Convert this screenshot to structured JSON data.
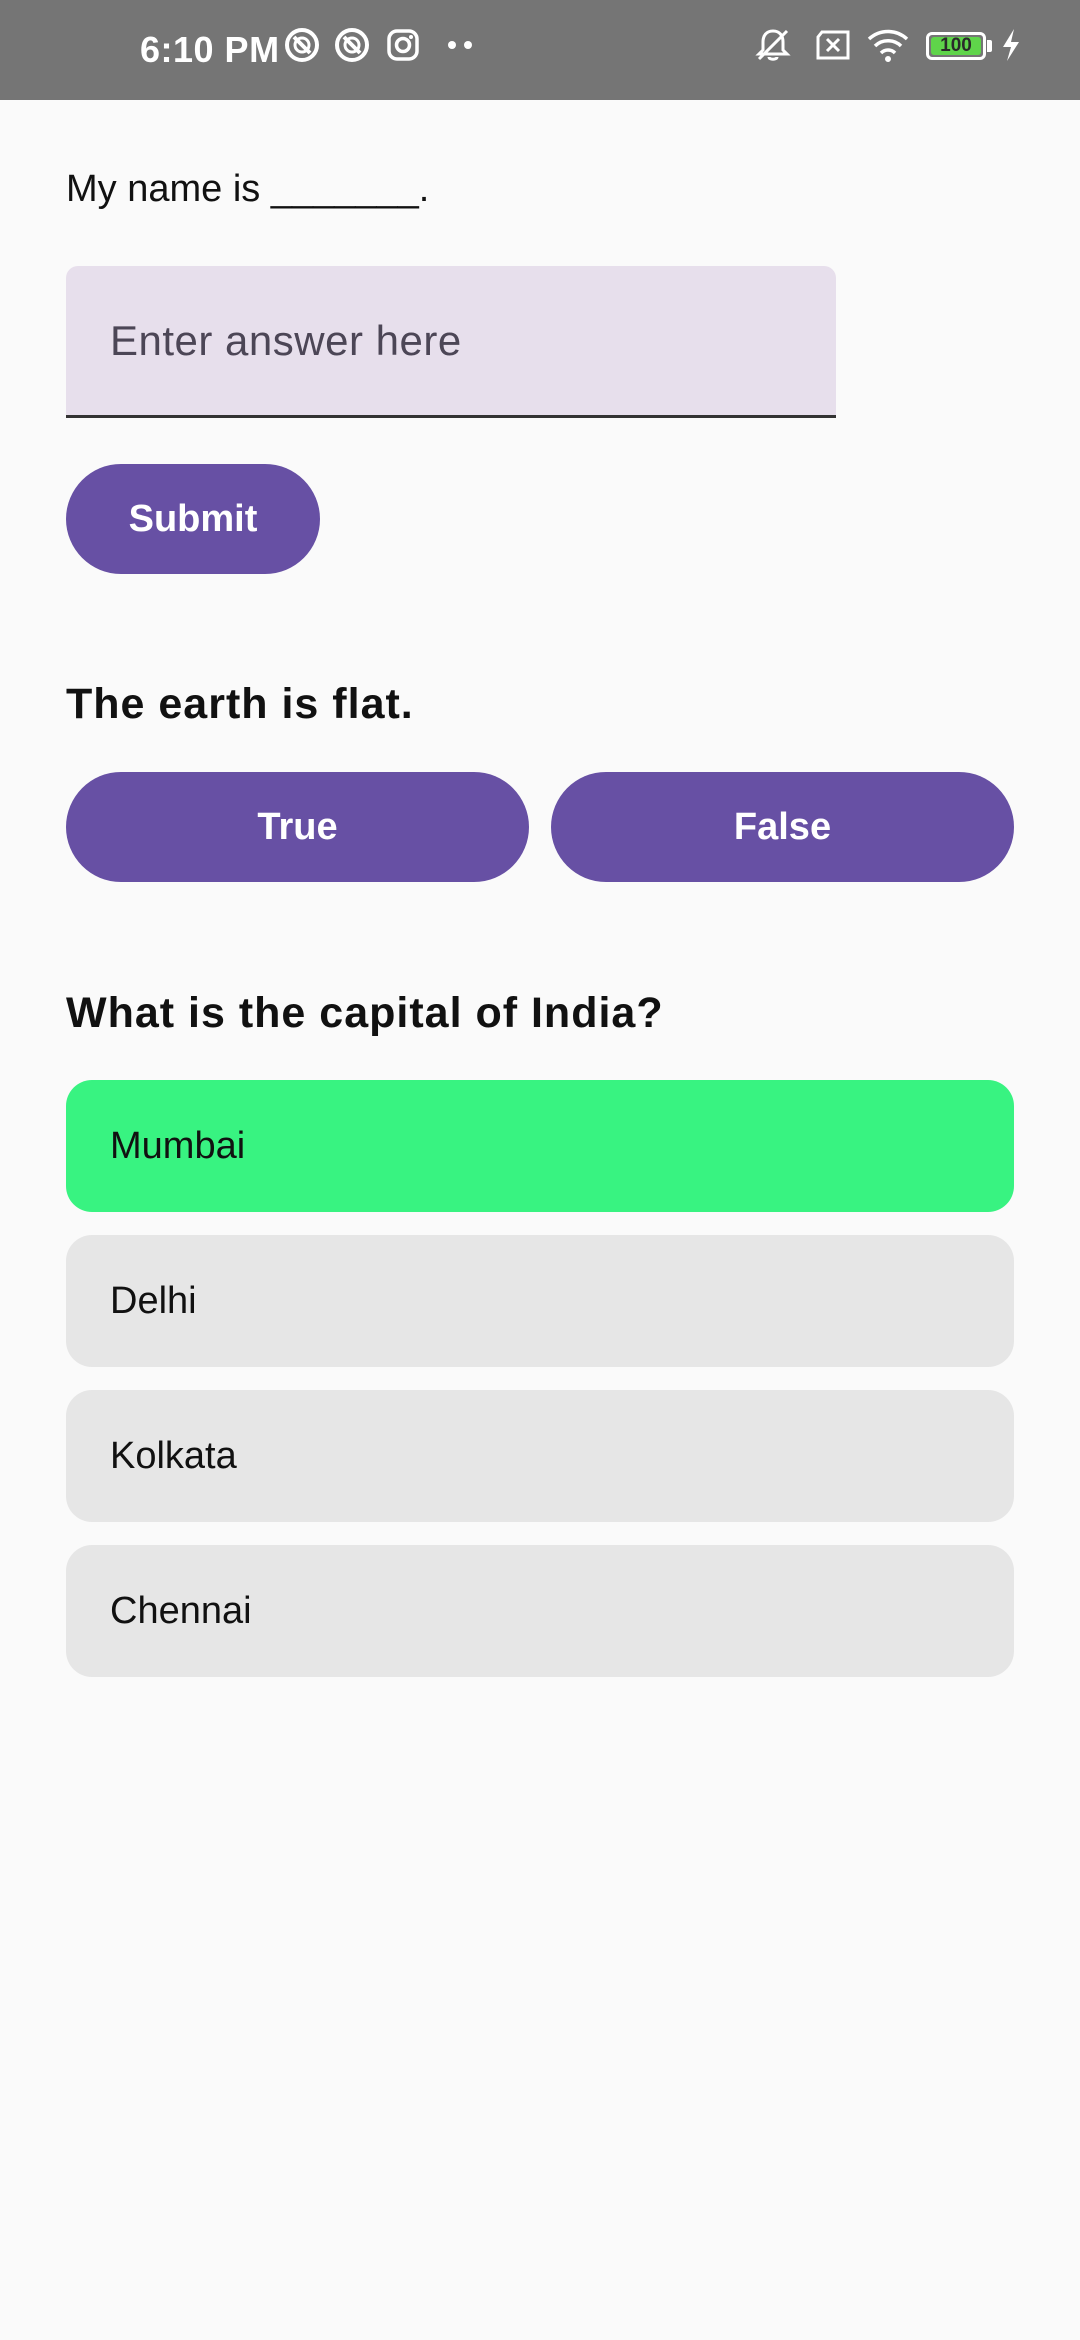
{
  "status_bar": {
    "time": "6:10 PM",
    "left_icons": [
      "sync-icon",
      "sync-icon",
      "instagram-icon",
      "more-dots-icon"
    ],
    "right_icons": [
      "silent-icon",
      "no-sim-icon",
      "wifi-icon",
      "battery-icon",
      "charging-icon"
    ],
    "battery_level": "100",
    "battery_color": "#5fd44a"
  },
  "fill_blank": {
    "question": "My name is _______.",
    "input_placeholder": "Enter answer here",
    "input_value": "",
    "submit_label": "Submit"
  },
  "true_false": {
    "question": "The earth is flat.",
    "true_label": "True",
    "false_label": "False"
  },
  "multiple_choice": {
    "question": "What is the capital of India?",
    "options": [
      "Mumbai",
      "Delhi",
      "Kolkata",
      "Chennai"
    ],
    "selected_option": "Mumbai",
    "selected_color": "#38f381",
    "option_color": "#e6e6e6"
  },
  "accent_color": "#6750a4"
}
